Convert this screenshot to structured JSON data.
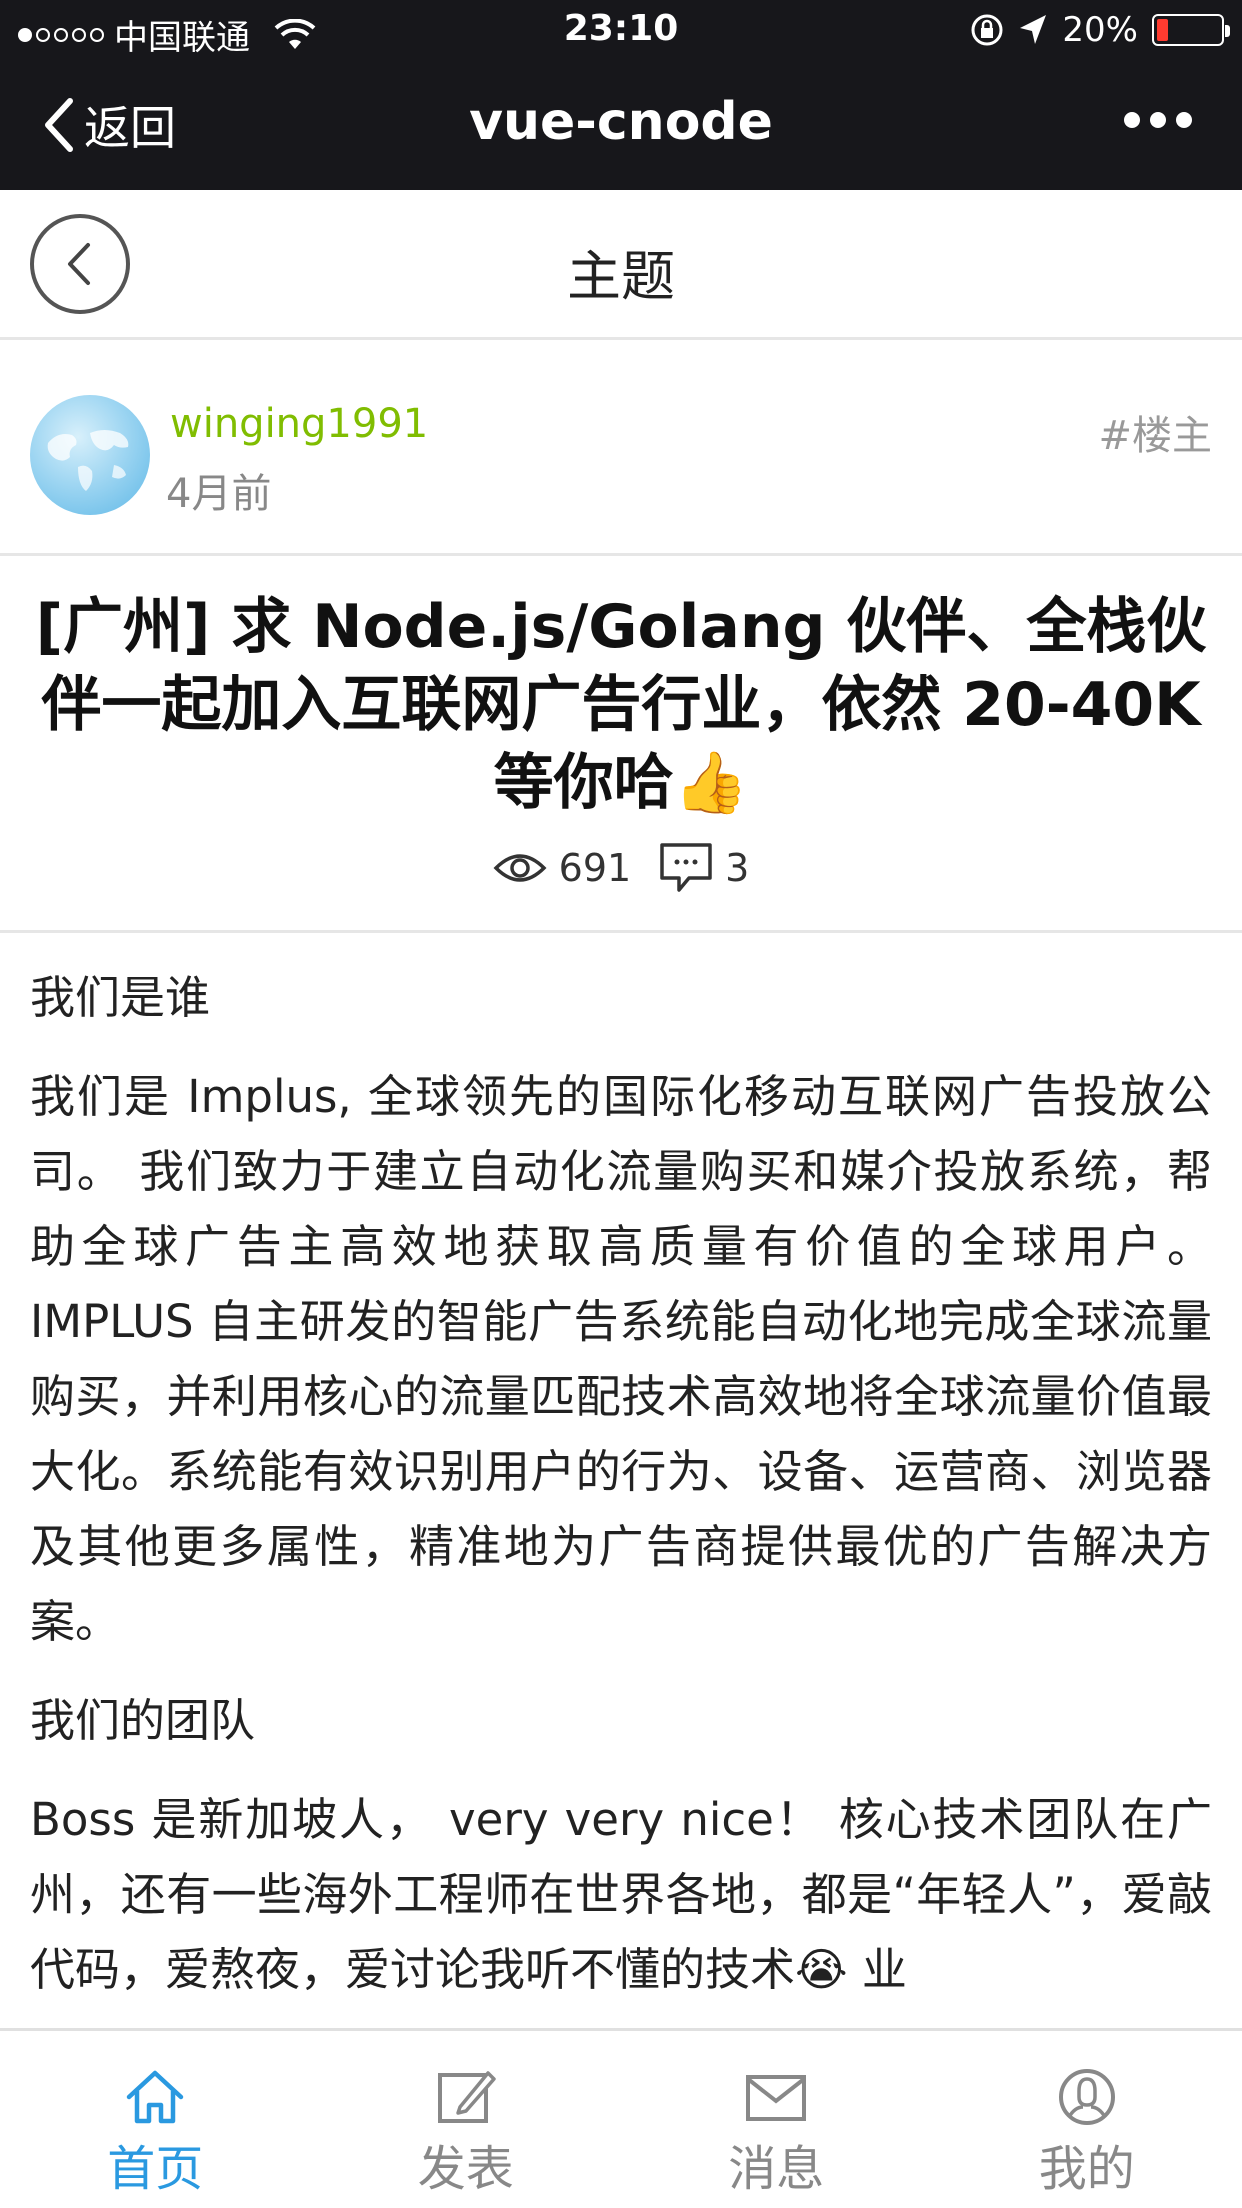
{
  "status_bar": {
    "carrier": "中国联通",
    "time": "23:10",
    "battery": "20%",
    "battery_level": 0.2
  },
  "wechat_nav": {
    "back_label": "返回",
    "title": "vue-cnode",
    "more_icon": "more-dots-icon"
  },
  "header": {
    "title": "主题",
    "back_icon": "chevron-left-icon"
  },
  "author": {
    "name": "winging1991",
    "time": "4月前",
    "tag": "#楼主",
    "name_color": "#80bd01"
  },
  "topic": {
    "title": "[广州] 求 Node.js/Golang 伙伴、全栈伙伴一起加入互联网广告行业，依然 20-40K 等你哈",
    "title_emoji": "👍",
    "views": "691",
    "comments": "3"
  },
  "content": {
    "heading1": "我们是谁",
    "para1": "我们是 Implus, 全球领先的国际化移动互联网广告投放公司。 我们致力于建立自动化流量购买和媒介投放系统，帮助全球广告主高效地获取高质量有价值的全球用户。 IMPLUS 自主研发的智能广告系统能自动化地完成全球流量购买，并利用核心的流量匹配技术高效地将全球流量价值最大化。系统能有效识别用户的行为、设备、运营商、浏览器及其他更多属性，精准地为广告商提供最优的广告解决方案。",
    "heading2": "我们的团队",
    "para2": "Boss 是新加坡人， very very nice！ 核心技术团队在广州，还有一些海外工程师在世界各地，都是“年轻人”，爱敲代码，爱熬夜，爱讨论我听不懂的技术😭 业"
  },
  "tabbar": {
    "active_color": "#2a99e0",
    "tabs": [
      {
        "label": "首页",
        "icon": "home-icon"
      },
      {
        "label": "发表",
        "icon": "edit-icon"
      },
      {
        "label": "消息",
        "icon": "mail-icon"
      },
      {
        "label": "我的",
        "icon": "user-icon"
      }
    ]
  }
}
